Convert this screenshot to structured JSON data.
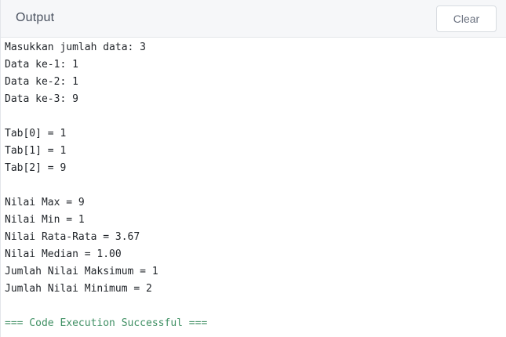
{
  "header": {
    "title": "Output",
    "clear_label": "Clear"
  },
  "console": {
    "lines": [
      "Masukkan jumlah data: 3",
      "Data ke-1: 1",
      "Data ke-2: 1",
      "Data ke-3: 9",
      "",
      "Tab[0] = 1",
      "Tab[1] = 1",
      "Tab[2] = 9",
      "",
      "Nilai Max = 9",
      "Nilai Min = 1",
      "Nilai Rata-Rata = 3.67",
      "Nilai Median = 1.00",
      "Jumlah Nilai Maksimum = 1",
      "Jumlah Nilai Minimum = 2",
      "",
      "=== Code Execution Successful ==="
    ]
  },
  "colors": {
    "success_text": "#3f8f63",
    "header_bg": "#f6f7f9"
  }
}
